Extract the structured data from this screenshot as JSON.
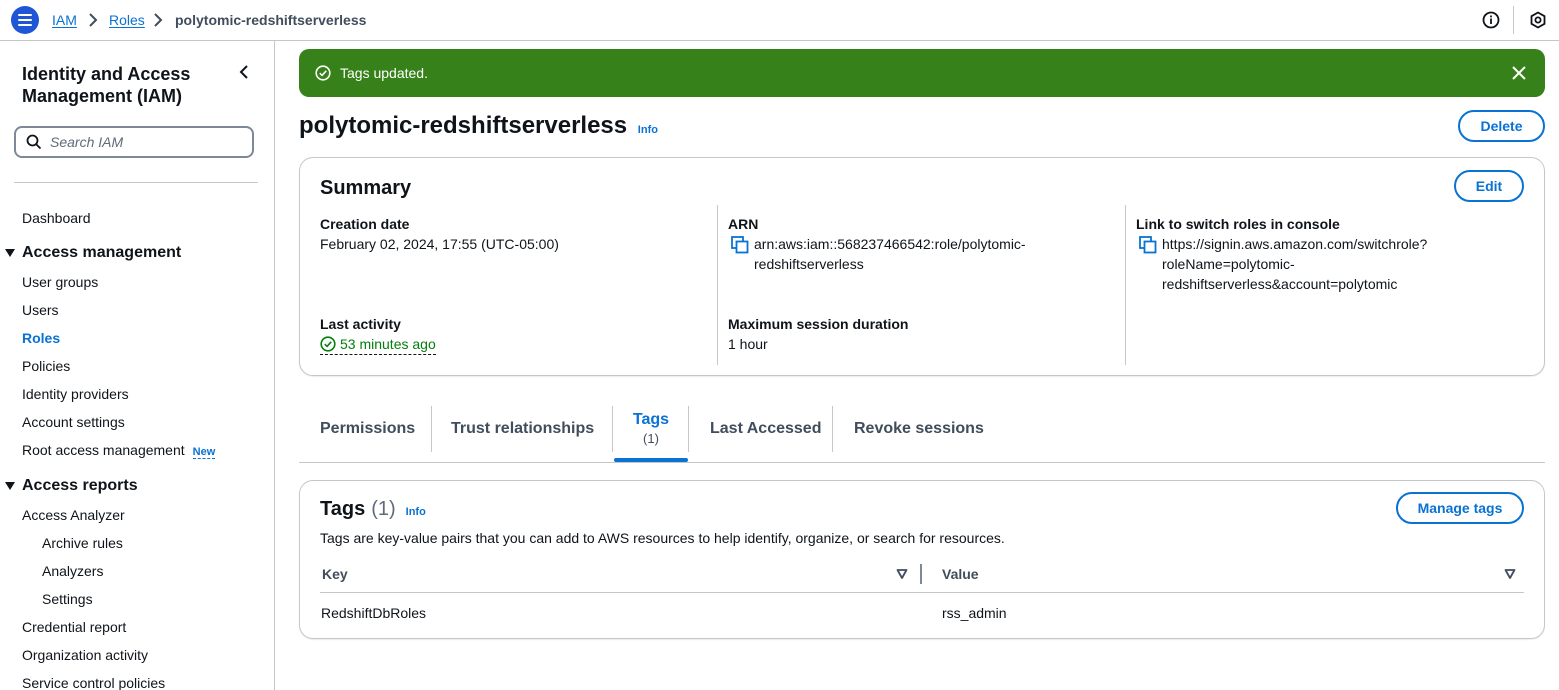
{
  "breadcrumb": {
    "items": [
      "IAM",
      "Roles"
    ],
    "current": "polytomic-redshiftserverless"
  },
  "sidebar": {
    "title": "Identity and Access Management (IAM)",
    "search_placeholder": "Search IAM",
    "dashboard": "Dashboard",
    "access_management": {
      "label": "Access management",
      "items": [
        "User groups",
        "Users",
        "Roles",
        "Policies",
        "Identity providers",
        "Account settings",
        "Root access management"
      ],
      "new_badge": "New"
    },
    "access_reports": {
      "label": "Access reports",
      "analyzer": "Access Analyzer",
      "analyzer_items": [
        "Archive rules",
        "Analyzers",
        "Settings"
      ],
      "items": [
        "Credential report",
        "Organization activity",
        "Service control policies"
      ]
    }
  },
  "flash": {
    "message": "Tags updated."
  },
  "page": {
    "title": "polytomic-redshiftserverless",
    "info": "Info",
    "delete_label": "Delete"
  },
  "summary": {
    "title": "Summary",
    "edit_label": "Edit",
    "creation_date_label": "Creation date",
    "creation_date": "February 02, 2024, 17:55 (UTC-05:00)",
    "last_activity_label": "Last activity",
    "last_activity": "53 minutes ago",
    "arn_label": "ARN",
    "arn_line1": "arn:aws:iam::568237466542:role/polytomic-",
    "arn_line2": "redshiftserverless",
    "max_session_label": "Maximum session duration",
    "max_session": "1 hour",
    "switch_label": "Link to switch roles in console",
    "switch_line1": "https://signin.aws.amazon.com/switchrole?",
    "switch_line2": "roleName=polytomic-",
    "switch_line3": "redshiftserverless&account=polytomic"
  },
  "tabs": {
    "permissions": "Permissions",
    "trust": "Trust relationships",
    "tags": "Tags",
    "tags_count": "(1)",
    "last_accessed": "Last Accessed",
    "revoke": "Revoke sessions"
  },
  "tags_panel": {
    "title": "Tags",
    "count": "(1)",
    "info": "Info",
    "manage_label": "Manage tags",
    "description": "Tags are key-value pairs that you can add to AWS resources to help identify, organize, or search for resources.",
    "columns": [
      "Key",
      "Value"
    ],
    "rows": [
      {
        "key": "RedshiftDbRoles",
        "value": "rss_admin"
      }
    ]
  },
  "colors": {
    "accent": "#0972d3",
    "success": "#37811a",
    "success_text": "#037f0c",
    "menu_button": "#1f56d6"
  }
}
